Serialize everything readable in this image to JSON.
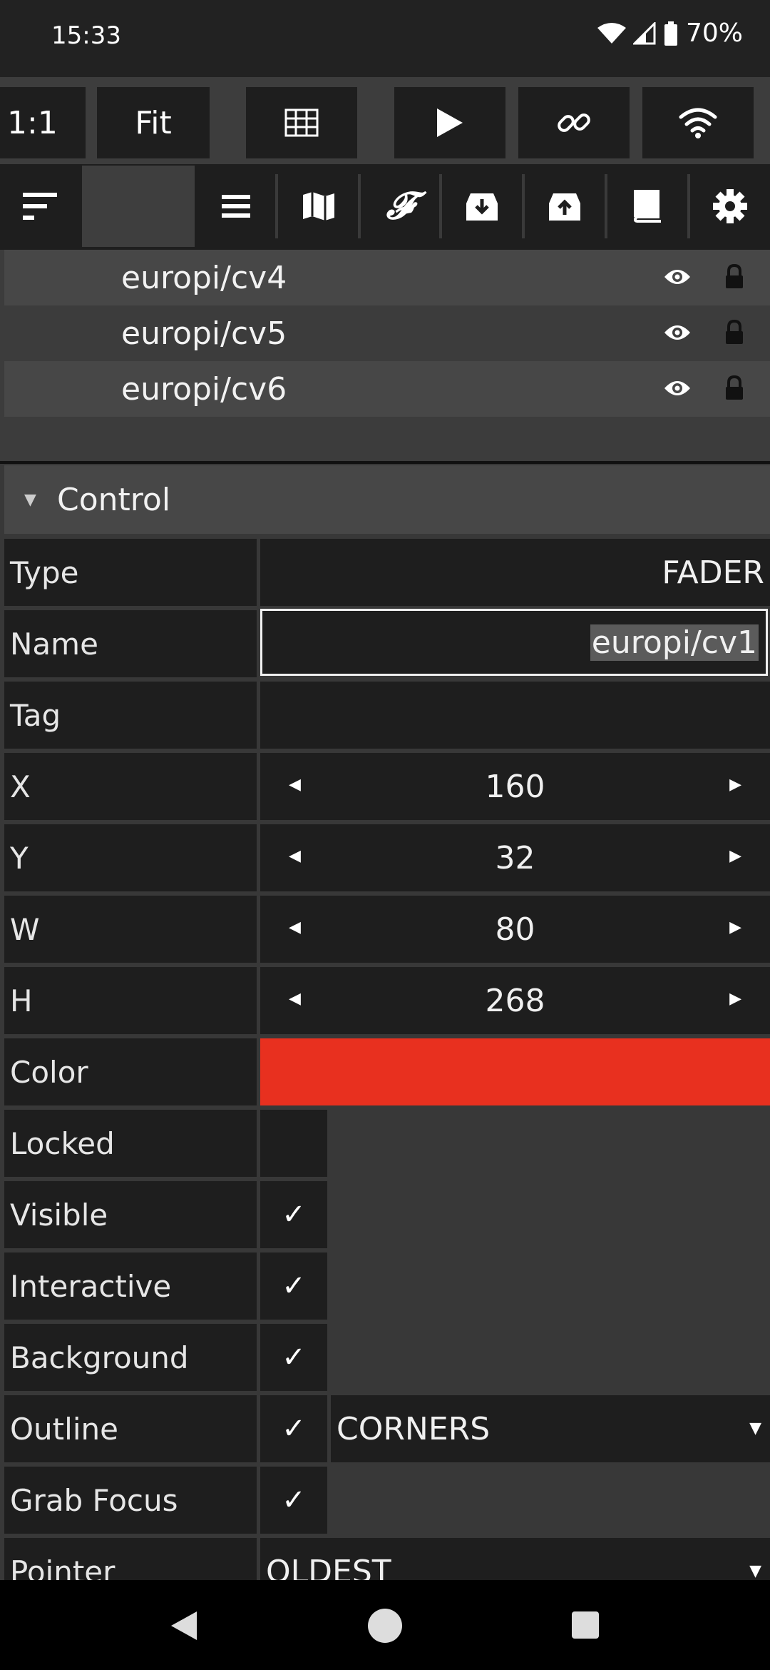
{
  "status": {
    "time": "15:33",
    "battery": "70%"
  },
  "toolbar1": {
    "zoom_1_1": "1:1",
    "fit": "Fit"
  },
  "layers": [
    {
      "name": "europi/cv4"
    },
    {
      "name": "europi/cv5"
    },
    {
      "name": "europi/cv6"
    }
  ],
  "section": {
    "title": "Control"
  },
  "props": {
    "type": {
      "label": "Type",
      "value": "FADER"
    },
    "name": {
      "label": "Name",
      "value": "europi/cv1"
    },
    "tag": {
      "label": "Tag",
      "value": ""
    },
    "x": {
      "label": "X",
      "value": "160"
    },
    "y": {
      "label": "Y",
      "value": "32"
    },
    "w": {
      "label": "W",
      "value": "80"
    },
    "h": {
      "label": "H",
      "value": "268"
    },
    "color": {
      "label": "Color",
      "value": "#e8301f"
    },
    "locked": {
      "label": "Locked",
      "checked": false
    },
    "visible": {
      "label": "Visible",
      "checked": true
    },
    "interactive": {
      "label": "Interactive",
      "checked": true
    },
    "background": {
      "label": "Background",
      "checked": true
    },
    "outline": {
      "label": "Outline",
      "checked": true,
      "style": "CORNERS"
    },
    "grab_focus": {
      "label": "Grab Focus",
      "checked": true
    },
    "pointer": {
      "label": "Pointer",
      "value": "OLDEST"
    }
  },
  "glyphs": {
    "check": "✓",
    "left": "◀",
    "right": "▶",
    "down": "▼",
    "collapse": "▼"
  }
}
